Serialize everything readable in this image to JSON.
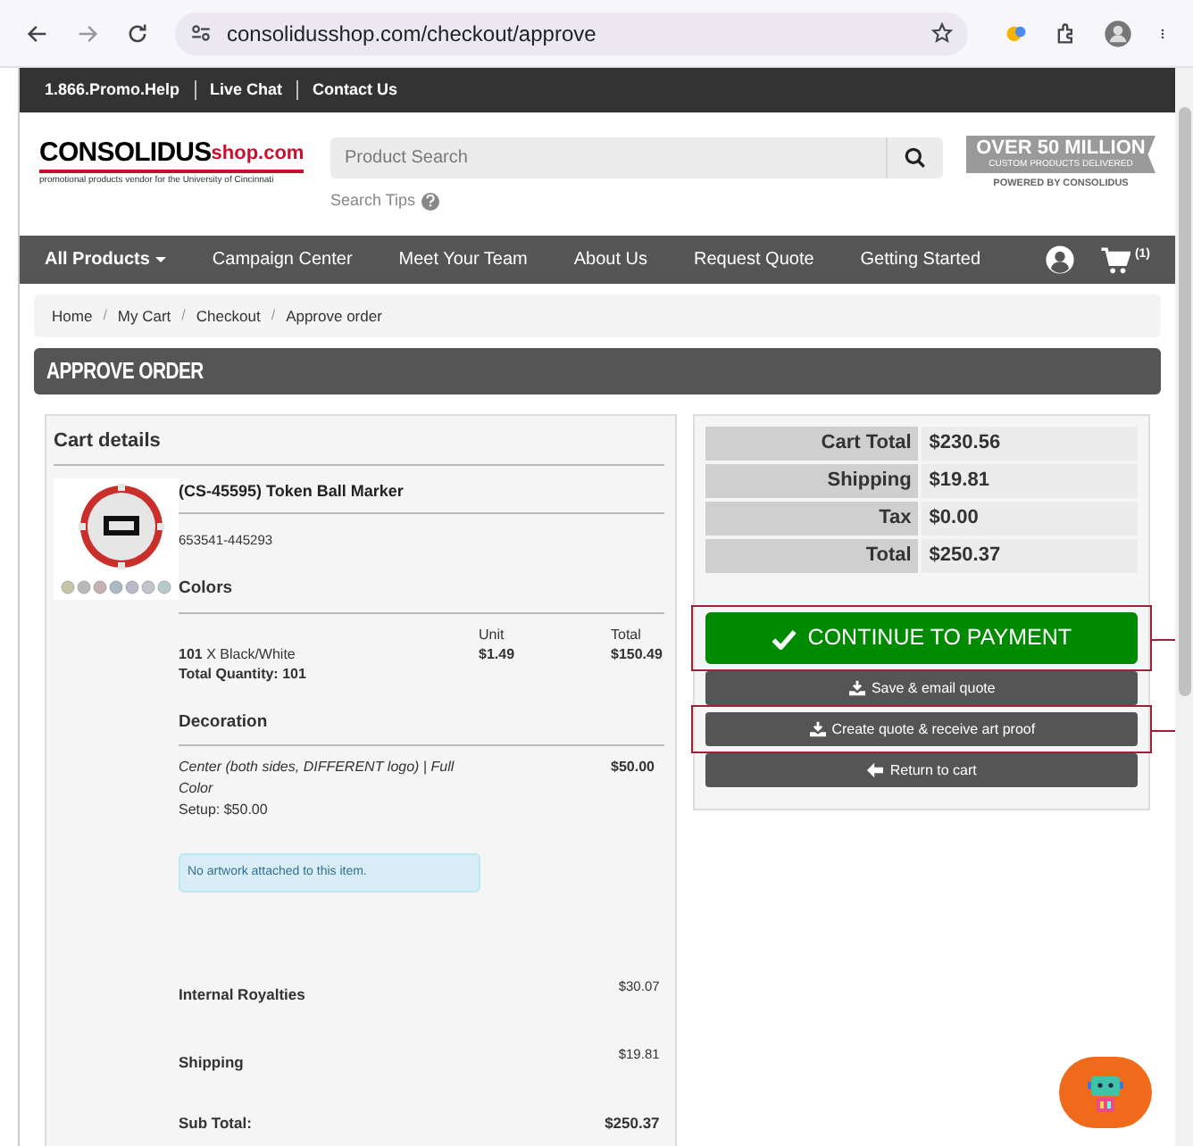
{
  "browser": {
    "url": "consolidusshop.com/checkout/approve"
  },
  "top_bar": {
    "links": [
      "1.866.Promo.Help",
      "Live Chat",
      "Contact Us"
    ]
  },
  "header": {
    "logo": {
      "brand": "CONSOLIDUS",
      "domain": "shop.com",
      "tagline": "promotional products vendor for the University of Cincinnati"
    },
    "search": {
      "placeholder": "Product Search",
      "tips": "Search Tips"
    },
    "banner": {
      "headline": "OVER 50 MILLION",
      "subline": "CUSTOM PRODUCTS DELIVERED",
      "powered": "POWERED BY CONSOLIDUS"
    }
  },
  "nav": {
    "items": [
      {
        "label": "All Products",
        "dropdown": true
      },
      {
        "label": "Campaign Center",
        "dropdown": false
      },
      {
        "label": "Meet Your Team",
        "dropdown": false
      },
      {
        "label": "About Us",
        "dropdown": false
      },
      {
        "label": "Request Quote",
        "dropdown": false
      },
      {
        "label": "Getting Started",
        "dropdown": false
      }
    ],
    "cart_count": "(1)"
  },
  "breadcrumb": {
    "separator": "/",
    "items": [
      "Home",
      "My Cart",
      "Checkout",
      "Approve order"
    ]
  },
  "page_title": "APPROVE ORDER",
  "cart": {
    "title": "Cart details",
    "product": {
      "kind": "picture",
      "name": "(CS-45595) Token Ball Marker",
      "sku": "653541-445293",
      "colors_heading": "Colors",
      "unit_heading": "Unit",
      "total_heading": "Total",
      "quantity_line": "**101** X Black/White",
      "total_quantity": "Total Quantity: 101",
      "unit_price": "$1.49",
      "line_total": "$150.49",
      "decoration_heading": "Decoration",
      "decoration": {
        "description": "Center (both sides, DIFFERENT logo) | Full Color",
        "setup": "Setup: $50.00",
        "price": "$50.00"
      },
      "artwork_notice": "No artwork attached to this item."
    },
    "fees": [
      {
        "label": "Internal Royalties",
        "amount": "$30.07"
      },
      {
        "label": "Shipping",
        "amount": "$19.81"
      }
    ],
    "subtotal": {
      "label": "Sub Total:",
      "amount": "$250.37"
    }
  },
  "summary": {
    "rows": [
      {
        "label": "Cart Total",
        "value": "$230.56"
      },
      {
        "label": "Shipping",
        "value": "$19.81"
      },
      {
        "label": "Tax",
        "value": "$0.00"
      },
      {
        "label": "Total",
        "value": "$250.37"
      }
    ],
    "buttons": [
      {
        "label": "CONTINUE TO PAYMENT",
        "kind": "primary",
        "highlighted": true
      },
      {
        "label": "Save & email quote",
        "kind": "download",
        "highlighted": false
      },
      {
        "label": "Create quote & receive art proof",
        "kind": "download",
        "highlighted": true
      },
      {
        "label": "Return to cart",
        "kind": "back",
        "highlighted": false
      }
    ]
  }
}
